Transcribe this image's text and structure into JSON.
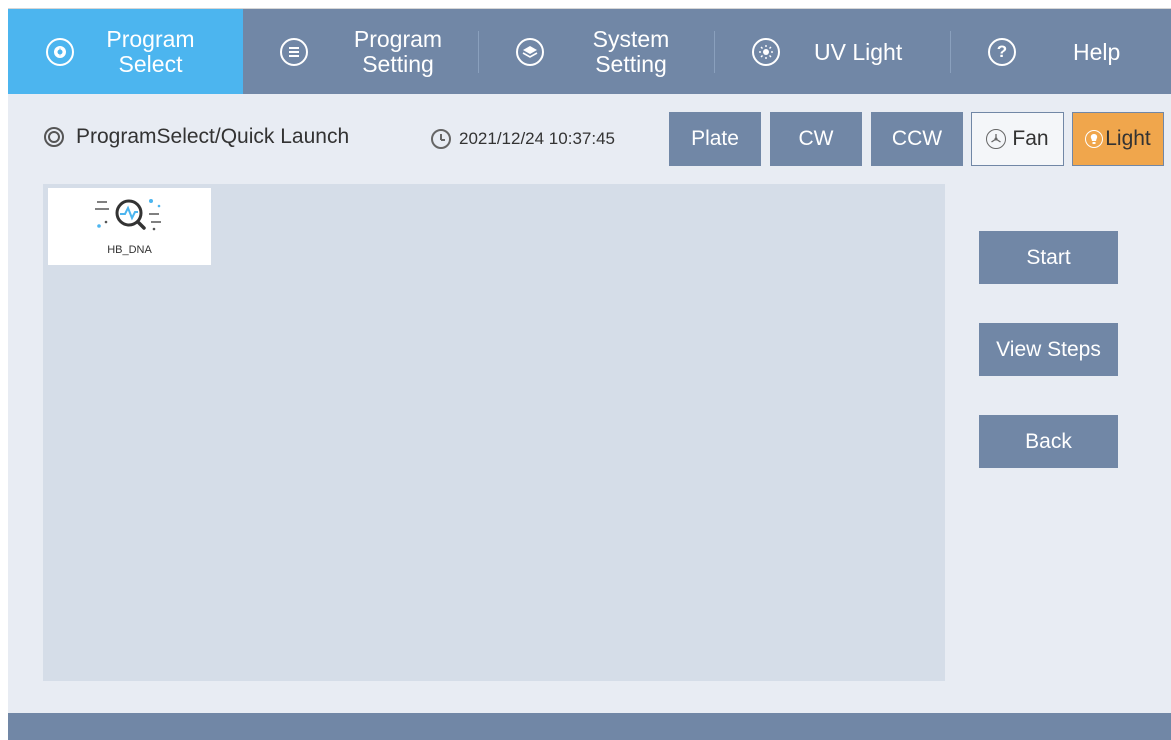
{
  "nav": {
    "items": [
      {
        "line1": "Program",
        "line2": "Select",
        "icon": "compass-icon",
        "active": true
      },
      {
        "line1": "Program",
        "line2": "Setting",
        "icon": "list-icon",
        "active": false
      },
      {
        "line1": "System",
        "line2": "Setting",
        "icon": "layers-icon",
        "active": false
      },
      {
        "line1": "UV Light",
        "line2": "",
        "icon": "sun-icon",
        "active": false
      },
      {
        "line1": "Help",
        "line2": "",
        "icon": "question-icon",
        "active": false
      }
    ]
  },
  "breadcrumb": "ProgramSelect/Quick Launch",
  "datetime": "2021/12/24 10:37:45",
  "toolbar": {
    "plate": "Plate",
    "cw": "CW",
    "ccw": "CCW",
    "fan": "Fan",
    "light": "Light"
  },
  "programs": [
    {
      "name": "HB_DNA",
      "icon": "search-chart-icon"
    }
  ],
  "actions": {
    "start": "Start",
    "view_steps": "View Steps",
    "back": "Back"
  },
  "colors": {
    "nav_bg": "#7187a6",
    "nav_active": "#4cb5ef",
    "light_button": "#f0a64c",
    "panel_bg": "#d5dde8"
  }
}
